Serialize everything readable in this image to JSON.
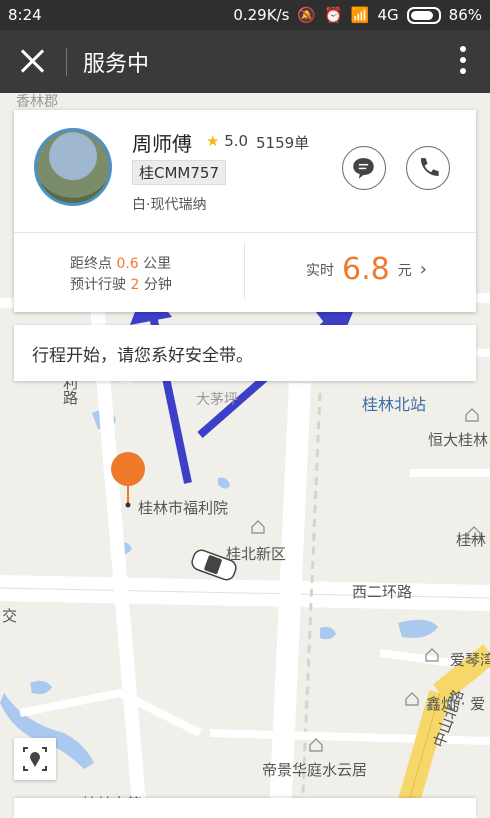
{
  "status_bar": {
    "time": "8:24",
    "speed": "0.29K/s",
    "network": "4G",
    "battery": "86%"
  },
  "app_bar": {
    "title": "服务中"
  },
  "driver": {
    "name": "周师傅",
    "rating": "5.0",
    "orders": "5159单",
    "plate": "桂CMM757",
    "car": "白·现代瑞纳"
  },
  "trip": {
    "distance_prefix": "距终点",
    "distance_value": "0.6",
    "distance_unit": "公里",
    "eta_prefix": "预计行驶",
    "eta_value": "2",
    "eta_unit": "分钟",
    "fare_label": "实时",
    "fare_value": "6.8",
    "fare_unit": "元",
    "fare_chevron": "›"
  },
  "notice": "行程开始，请您系好安全带。",
  "map": {
    "labels": {
      "xianglin": "香林郡",
      "lilu": "利路",
      "damaoping": "大茅坪",
      "guilin_north": "桂林北站",
      "hengda": "恒大桂林",
      "end_marker": "终",
      "welfare": "桂林市福利院",
      "guilin_right": "桂林",
      "guibei": "桂北新区",
      "xier": "西二环路",
      "jiao": "交",
      "aiqin": "爱琴湾",
      "xinshan": "鑫灿 · 爱",
      "zhongshan": "中山北路",
      "dijing": "帝景华庭水云居",
      "guilin_city": "桂林市第"
    },
    "colors": {
      "road": "#ffffff",
      "main_road": "#f6d86a",
      "water": "#a9c9ee",
      "route": "#3d3fc9",
      "marker": "#f07a2b"
    }
  },
  "icons": {
    "close": "close-icon",
    "more": "more-vert-icon",
    "message": "message-icon",
    "phone": "phone-icon",
    "locate": "locate-icon",
    "star": "star-icon",
    "car": "car-icon"
  }
}
